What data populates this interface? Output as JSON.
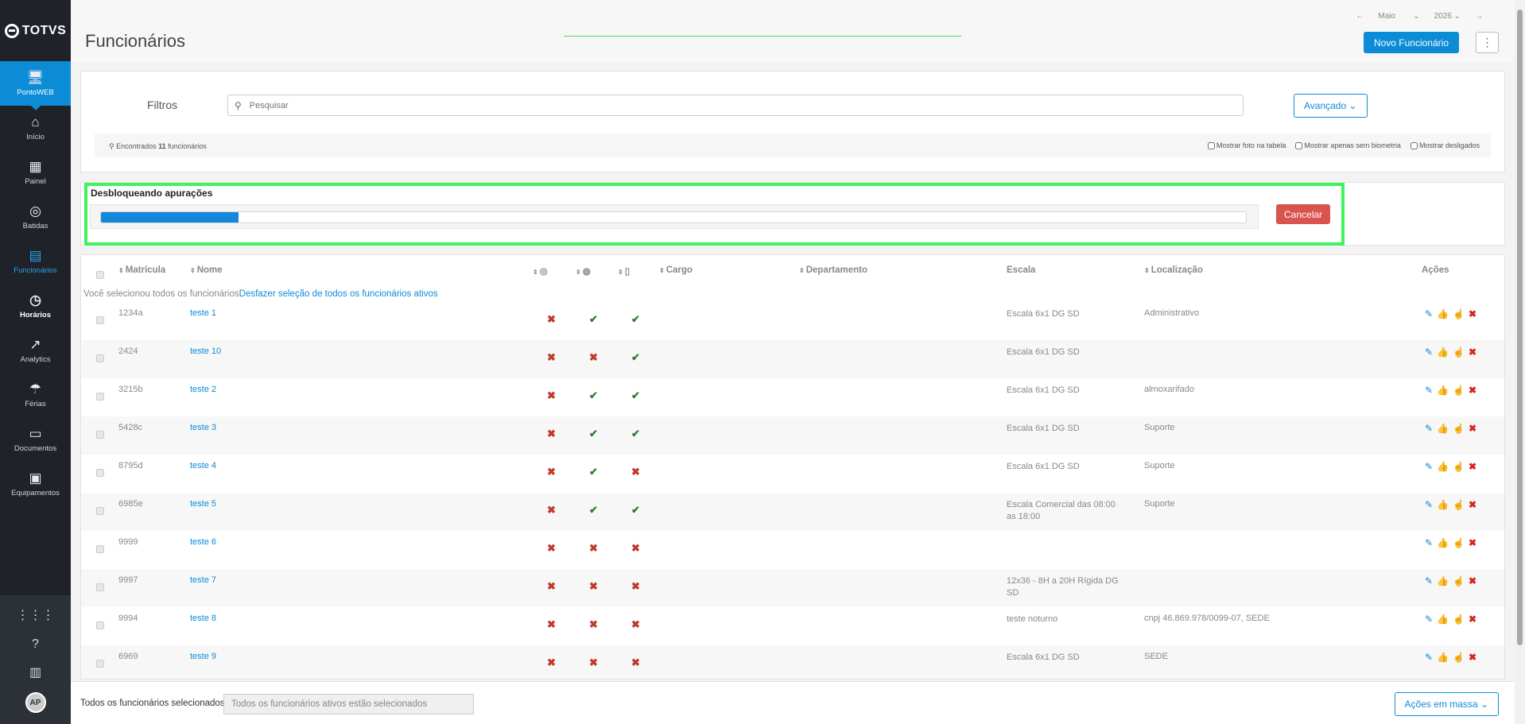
{
  "brand": "TOTVS",
  "sidebar": {
    "items": [
      {
        "label": "PontoWEB",
        "icon": "monitor-icon",
        "glyph": "🖥"
      },
      {
        "label": "Início",
        "icon": "home-icon",
        "glyph": "⌂"
      },
      {
        "label": "Painel",
        "icon": "dashboard-icon",
        "glyph": "▦"
      },
      {
        "label": "Batidas",
        "icon": "fingerprint-icon",
        "glyph": "◎"
      },
      {
        "label": "Funcionários",
        "icon": "badge-icon",
        "glyph": "▤"
      },
      {
        "label": "Horários",
        "icon": "clock-icon",
        "glyph": "◷"
      },
      {
        "label": "Analytics",
        "icon": "trend-icon",
        "glyph": "↗"
      },
      {
        "label": "Férias",
        "icon": "umbrella-icon",
        "glyph": "☂"
      },
      {
        "label": "Documentos",
        "icon": "document-icon",
        "glyph": "▭"
      },
      {
        "label": "Equipamentos",
        "icon": "device-icon",
        "glyph": "▣"
      }
    ],
    "bottom": {
      "apps_glyph": "⋮⋮⋮",
      "help_glyph": "?",
      "company_glyph": "▥",
      "avatar": "AP"
    }
  },
  "header": {
    "title": "Funcionários",
    "month": "Maio",
    "year": "2026",
    "prev": "←",
    "next": "→",
    "new_button": "Novo Funcionário",
    "more": "⋮"
  },
  "filters": {
    "label": "Filtros",
    "search_placeholder": "Pesquisar",
    "advanced": "Avançado",
    "found_prefix": "Encontrados",
    "found_count": "11",
    "found_suffix": "funcionários",
    "check_photo": "Mostrar foto na tabela",
    "check_biometry": "Mostrar apenas sem biometria",
    "check_dismissed": "Mostrar desligados"
  },
  "progress": {
    "title": "Desbloqueando apurações",
    "fraction": 0.12,
    "cancel": "Cancelar"
  },
  "table": {
    "headers": {
      "matricula": "Matrícula",
      "nome": "Nome",
      "cargo": "Cargo",
      "departamento": "Departamento",
      "escala": "Escala",
      "localizacao": "Localização",
      "acoes": "Ações"
    },
    "selection_note": "Você selecionou todos os funcionários",
    "selection_undo": "Desfazer seleção de todos os funcionários ativos",
    "rows": [
      {
        "matricula": "1234a",
        "nome": "teste 1",
        "bio": false,
        "web": true,
        "mobile": true,
        "escala": "Escala 6x1 DG SD",
        "local": "Administrativo"
      },
      {
        "matricula": "2424",
        "nome": "teste 10",
        "bio": false,
        "web": false,
        "mobile": true,
        "escala": "Escala 6x1 DG SD",
        "local": ""
      },
      {
        "matricula": "3215b",
        "nome": "teste 2",
        "bio": false,
        "web": true,
        "mobile": true,
        "escala": "Escala 6x1 DG SD",
        "local": "almoxarifado"
      },
      {
        "matricula": "5428c",
        "nome": "teste 3",
        "bio": false,
        "web": true,
        "mobile": true,
        "escala": "Escala 6x1 DG SD",
        "local": "Suporte"
      },
      {
        "matricula": "8795d",
        "nome": "teste 4",
        "bio": false,
        "web": true,
        "mobile": false,
        "escala": "Escala 6x1 DG SD",
        "local": "Suporte"
      },
      {
        "matricula": "6985e",
        "nome": "teste 5",
        "bio": false,
        "web": true,
        "mobile": true,
        "escala": "Escala Comercial das 08:00 as 18:00",
        "local": "Suporte"
      },
      {
        "matricula": "9999",
        "nome": "teste 6",
        "bio": false,
        "web": false,
        "mobile": false,
        "escala": "",
        "local": ""
      },
      {
        "matricula": "9997",
        "nome": "teste 7",
        "bio": false,
        "web": false,
        "mobile": false,
        "escala": "12x36 - 8H a 20H Rígida DG SD",
        "local": ""
      },
      {
        "matricula": "9994",
        "nome": "teste 8",
        "bio": false,
        "web": false,
        "mobile": false,
        "escala": "teste noturno",
        "local": "cnpj 46.869.978/0099-07, SEDE"
      },
      {
        "matricula": "6969",
        "nome": "teste 9",
        "bio": false,
        "web": false,
        "mobile": false,
        "escala": "Escala 6x1 DG SD",
        "local": "SEDE"
      }
    ]
  },
  "footer": {
    "label": "Todos os funcionários selecionados",
    "input_value": "Todos os funcionários ativos estão selecionados",
    "mass_actions": "Ações em massa"
  }
}
